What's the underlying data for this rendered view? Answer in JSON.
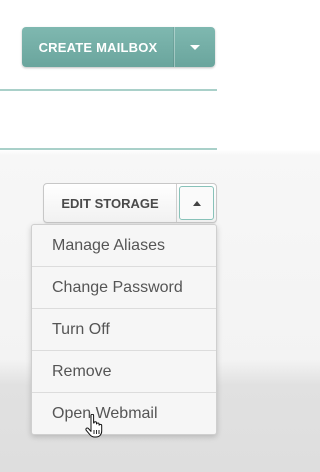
{
  "toolbar": {
    "create_label": "CREATE MAILBOX",
    "create_caret_icon": "chevron-down-icon"
  },
  "storage": {
    "edit_label": "EDIT STORAGE",
    "edit_caret_icon": "chevron-up-icon"
  },
  "menu": {
    "items": [
      {
        "label": "Manage Aliases"
      },
      {
        "label": "Change Password"
      },
      {
        "label": "Turn Off"
      },
      {
        "label": "Remove"
      },
      {
        "label": "Open Webmail"
      }
    ]
  },
  "cursor": {
    "icon": "hand-pointer-icon"
  },
  "colors": {
    "accent": "#6aa59d",
    "divider": "#a9d0c9"
  }
}
